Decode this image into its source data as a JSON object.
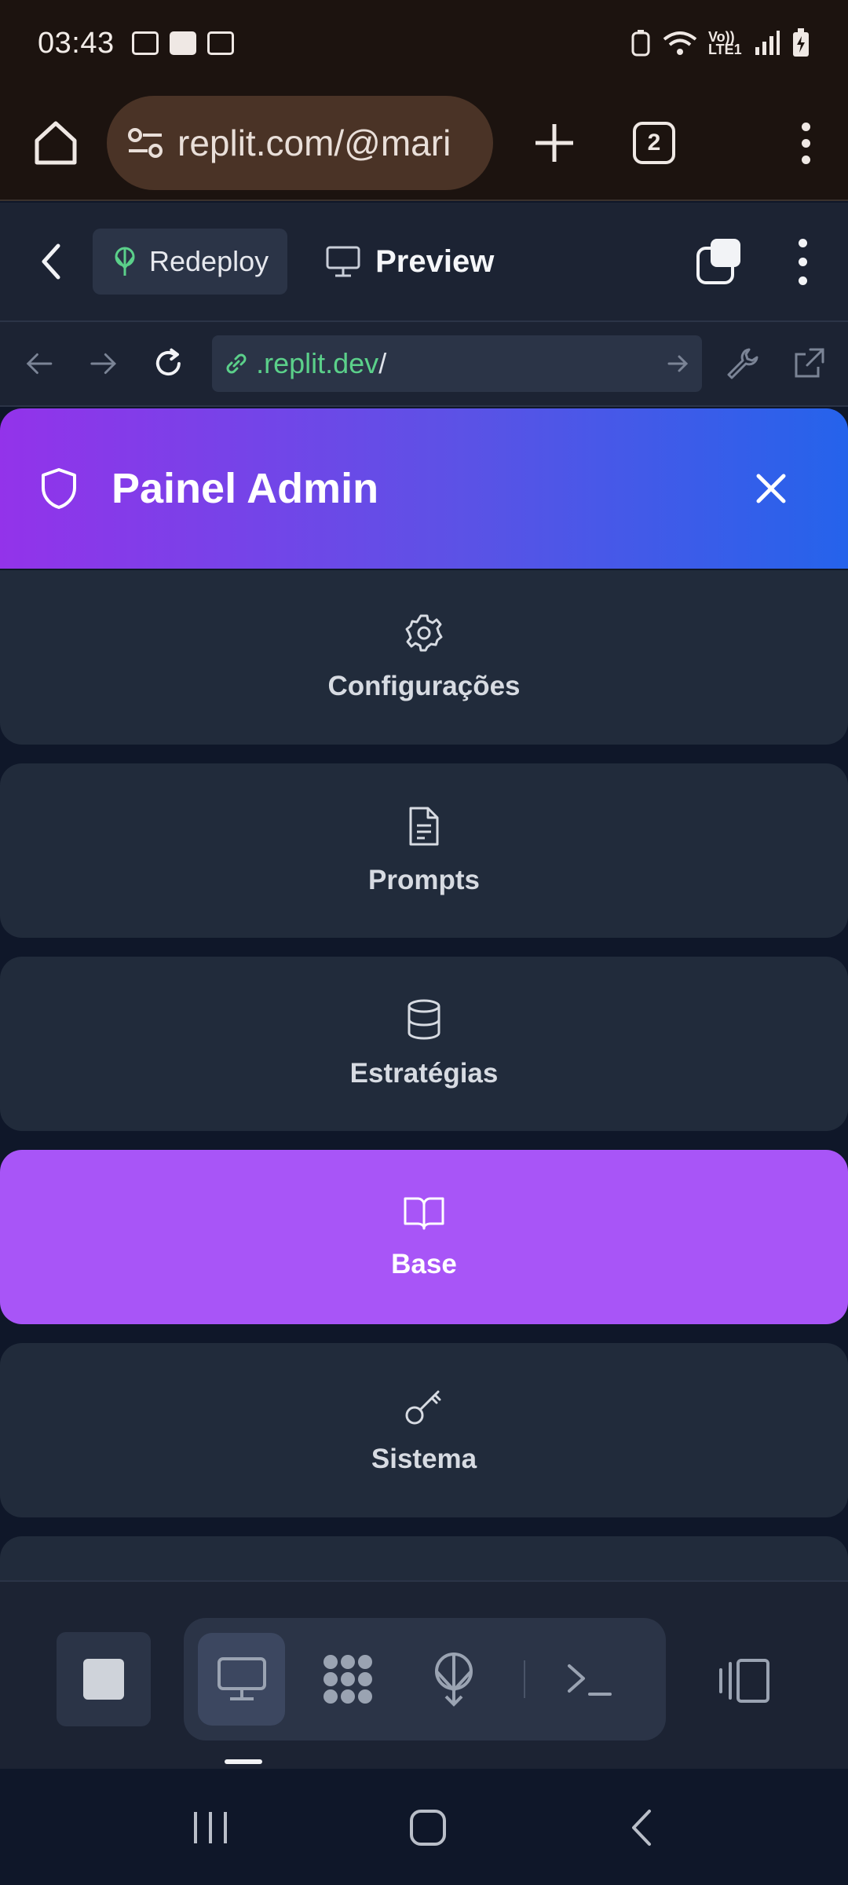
{
  "status_bar": {
    "time": "03:43",
    "network": "Vo)) LTE1"
  },
  "browser": {
    "url": "replit.com/@mari",
    "tab_count": "2"
  },
  "replit": {
    "redeploy_label": "Redeploy",
    "preview_label": "Preview",
    "url_domain": ".replit.dev",
    "url_path": "/"
  },
  "admin": {
    "title": "Painel Admin",
    "menu": [
      {
        "label": "Configurações",
        "icon": "gear-icon"
      },
      {
        "label": "Prompts",
        "icon": "file-text-icon"
      },
      {
        "label": "Estratégias",
        "icon": "database-icon"
      },
      {
        "label": "Base",
        "icon": "book-open-icon",
        "active": true
      },
      {
        "label": "Sistema",
        "icon": "key-icon"
      }
    ]
  },
  "colors": {
    "accent": "#a855f7",
    "gradient_start": "#9333ea",
    "gradient_end": "#2563eb",
    "card": "#212b3b",
    "replit_green": "#5bd08a"
  }
}
